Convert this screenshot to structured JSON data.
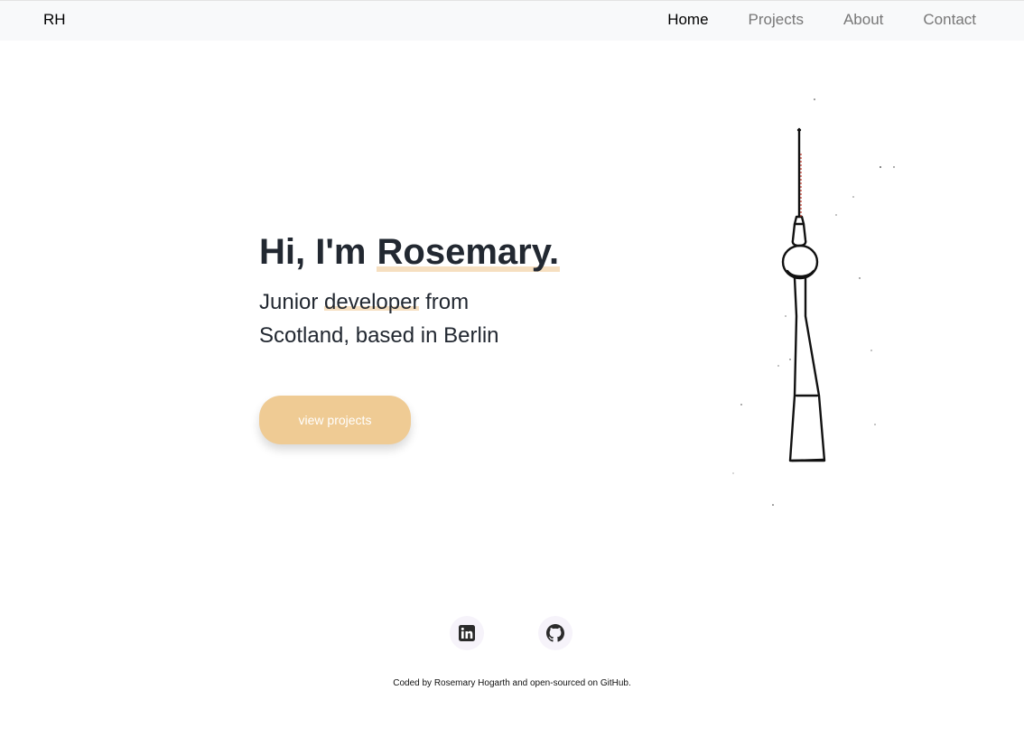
{
  "nav": {
    "brand": "RH",
    "links": [
      {
        "label": "Home",
        "active": true
      },
      {
        "label": "Projects",
        "active": false
      },
      {
        "label": "About",
        "active": false
      },
      {
        "label": "Contact",
        "active": false
      }
    ]
  },
  "hero": {
    "greeting": "Hi, I'm ",
    "name": "Rosemary.",
    "subtitle_before": "Junior ",
    "subtitle_highlight": "developer",
    "subtitle_after": " from Scotland, based in Berlin",
    "cta_label": "view projects"
  },
  "illustration": {
    "icon": "tv-tower-sketch-icon"
  },
  "social": [
    {
      "icon": "linkedin-icon"
    },
    {
      "icon": "github-icon"
    }
  ],
  "footer": {
    "text": "Coded by Rosemary Hogarth and open-sourced on GitHub."
  },
  "colors": {
    "accent": "#efcb94",
    "highlight": "#f6dfc0",
    "navbar_bg": "#f8f9fa",
    "text_dark": "#222831",
    "social_bg": "#f6f3fa"
  }
}
